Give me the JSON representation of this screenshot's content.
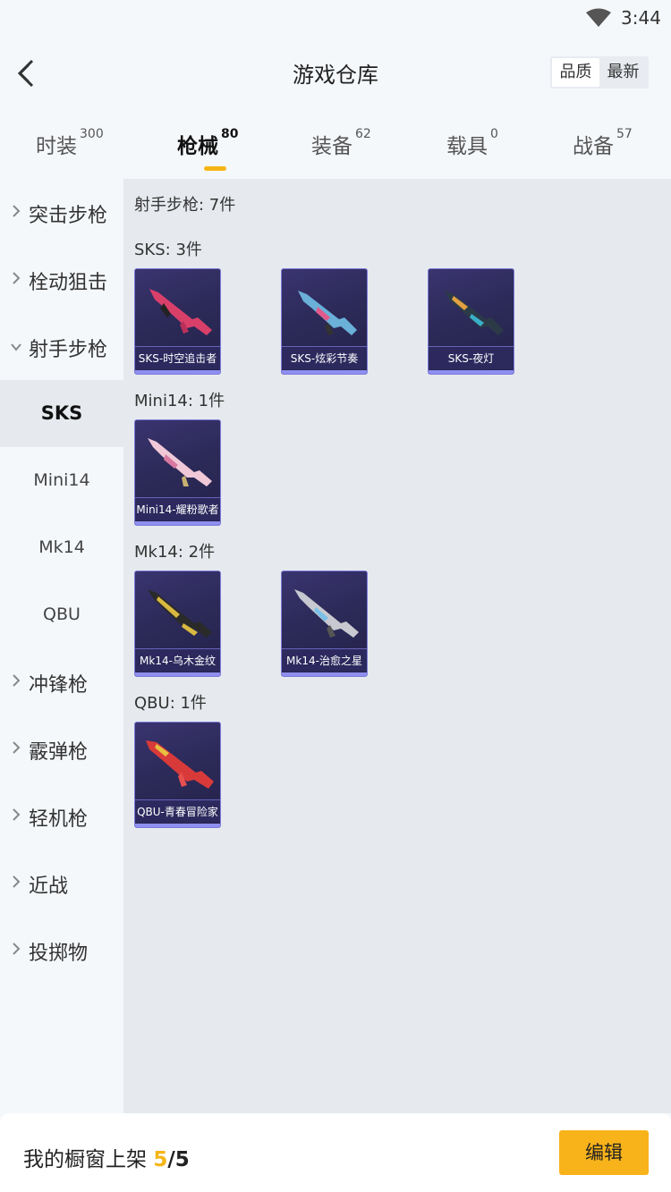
{
  "status_bar": {
    "time": "3:44",
    "wifi_icon": "wifi-icon"
  },
  "header": {
    "title": "游戏仓库",
    "sort_options": [
      "品质",
      "最新"
    ],
    "active_sort": "品质"
  },
  "tabs": [
    {
      "label": "时装",
      "count": "300"
    },
    {
      "label": "枪械",
      "count": "80"
    },
    {
      "label": "装备",
      "count": "62"
    },
    {
      "label": "载具",
      "count": "0"
    },
    {
      "label": "战备",
      "count": "57"
    }
  ],
  "active_tab": "枪械",
  "sidebar": {
    "categories": [
      "突击步枪",
      "栓动狙击",
      "射手步枪",
      "冲锋枪",
      "霰弹枪",
      "轻机枪",
      "近战",
      "投掷物"
    ],
    "expanded": "射手步枪",
    "subitems": [
      "SKS",
      "Mini14",
      "Mk14",
      "QBU"
    ],
    "active_sub": "SKS"
  },
  "main": {
    "summary": "射手步枪: 7件",
    "groups": [
      {
        "heading": "SKS: 3件",
        "items": [
          "SKS-时空追击者",
          "SKS-炫彩节奏",
          "SKS-夜灯"
        ]
      },
      {
        "heading": "Mini14: 1件",
        "items": [
          "Mini14-耀粉歌者"
        ]
      },
      {
        "heading": "Mk14: 2件",
        "items": [
          "Mk14-乌木金纹",
          "Mk14-治愈之星"
        ]
      },
      {
        "heading": "QBU: 1件",
        "items": [
          "QBU-青春冒险家"
        ]
      }
    ]
  },
  "bottom": {
    "label": "我的橱窗上架",
    "current": "5",
    "total": "/5",
    "edit_label": "编辑"
  },
  "colors": {
    "accent": "#f5b515",
    "card_bg": "#2c2a58",
    "card_border": "#7d7bd8"
  }
}
